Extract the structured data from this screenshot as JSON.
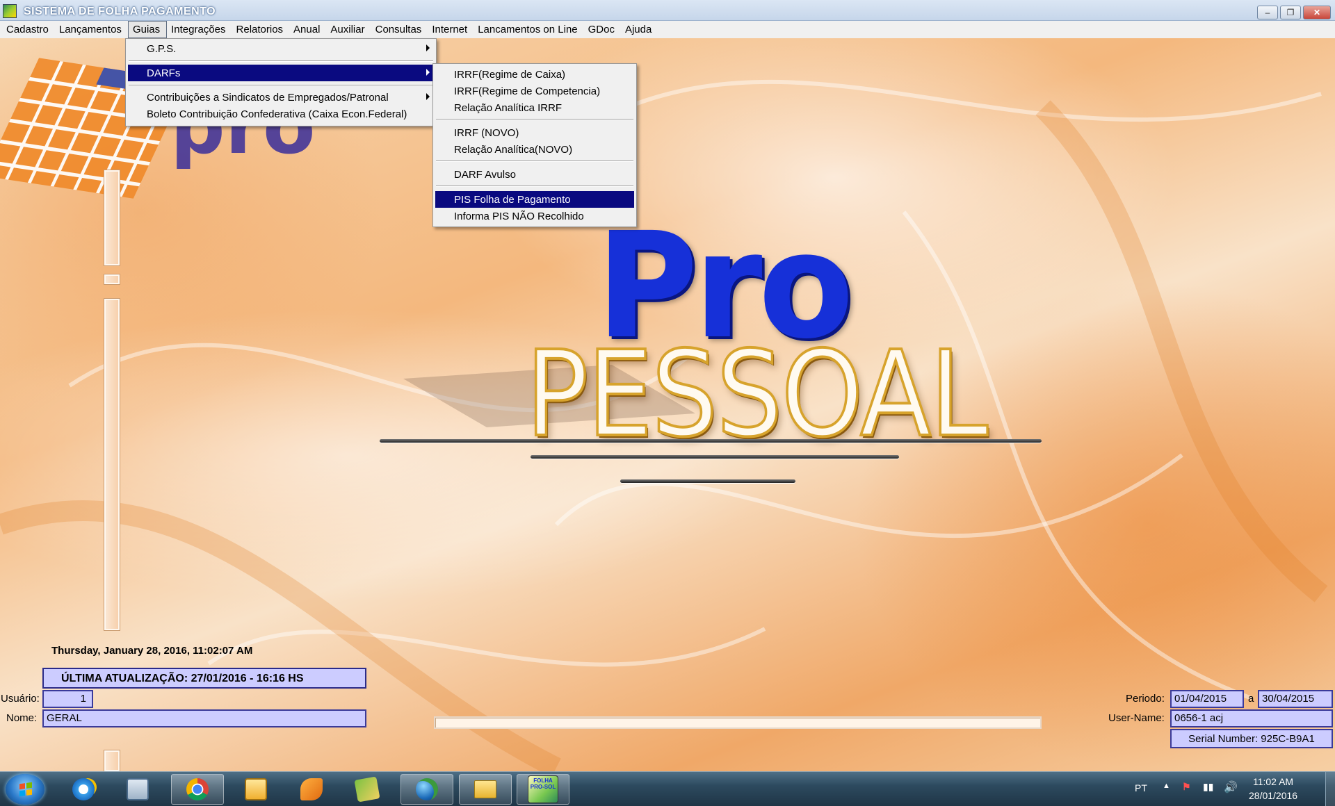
{
  "window": {
    "title": "SISTEMA DE FOLHA PAGAMENTO",
    "min": "–",
    "max": "❐",
    "close": "✕"
  },
  "menubar": [
    {
      "label": "Cadastro"
    },
    {
      "label": "Lançamentos"
    },
    {
      "label": "Guias",
      "active": true
    },
    {
      "label": "Integrações"
    },
    {
      "label": "Relatorios"
    },
    {
      "label": "Anual"
    },
    {
      "label": "Auxiliar"
    },
    {
      "label": "Consultas"
    },
    {
      "label": "Internet"
    },
    {
      "label": "Lancamentos on Line"
    },
    {
      "label": "GDoc"
    },
    {
      "label": "Ajuda"
    }
  ],
  "guias_menu": {
    "gps": "G.P.S.",
    "darfs": "DARFs",
    "contribuicoes": "Contribuições a Sindicatos de Empregados/Patronal",
    "boleto": "Boleto Contribuição Confederativa (Caixa Econ.Federal)"
  },
  "darfs_menu": {
    "irrf_caixa": "IRRF(Regime de Caixa)",
    "irrf_competencia": "IRRF(Regime de Competencia)",
    "relacao_irrf": "Relação Analítica IRRF",
    "irrf_novo": "IRRF (NOVO)",
    "relacao_novo": "Relação Analítica(NOVO)",
    "darf_avulso": "DARF  Avulso",
    "pis_folha": "PIS Folha de Pagamento",
    "informa_pis": "Informa PIS NÃO Recolhido"
  },
  "logo": {
    "pro": "Pro",
    "pessoal": "PESSOAL"
  },
  "info": {
    "datetime": "Thursday, January 28, 2016, 11:02:07 AM",
    "last_update": "ÚLTIMA ATUALIZAÇÃO:   27/01/2016 - 16:16 HS",
    "usuario_label": "Usuário:",
    "usuario_value": "1",
    "nome_label": "Nome:",
    "nome_value": "GERAL",
    "periodo_label": "Periodo:",
    "periodo_start": "01/04/2015",
    "periodo_sep": "a",
    "periodo_end": "30/04/2015",
    "username_label": "User-Name:",
    "username_value": "0656-1 acj",
    "serial": "Serial Number: 925C-B9A1"
  },
  "taskbar": {
    "lang": "PT",
    "time": "11:02 AM",
    "date": "28/01/2016",
    "app_label": "FOLHA PRO-SOL"
  },
  "colors": {
    "menu_highlight": "#0a0a80",
    "field_bg": "#ccccff",
    "logo_blue": "#1630d8"
  }
}
